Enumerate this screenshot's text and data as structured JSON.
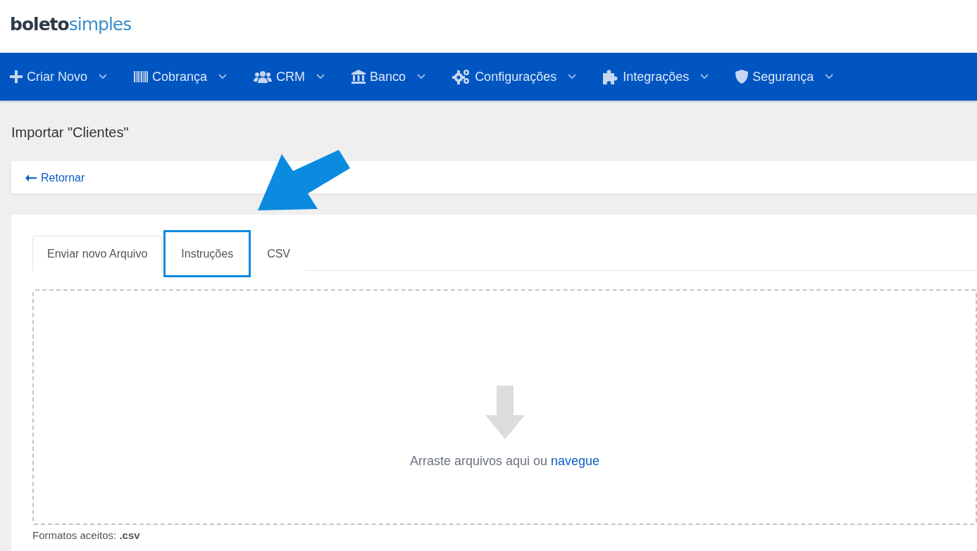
{
  "logo": {
    "part_1": "boleto",
    "part_2": "simples"
  },
  "nav": [
    {
      "label": "Criar Novo"
    },
    {
      "label": "Cobrança"
    },
    {
      "label": "CRM"
    },
    {
      "label": "Banco"
    },
    {
      "label": "Configurações"
    },
    {
      "label": "Integrações"
    },
    {
      "label": "Segurança"
    }
  ],
  "page_title": "Importar \"Clientes\"",
  "back_link": "Retornar",
  "tabs": [
    {
      "label": "Enviar novo Arquivo",
      "selected": true,
      "highlighted": false
    },
    {
      "label": "Instruções",
      "selected": false,
      "highlighted": true
    },
    {
      "label": "CSV",
      "selected": false,
      "highlighted": false
    }
  ],
  "annotation_arrow": true,
  "dropzone": {
    "text": "Arraste arquivos aqui ou",
    "link": "navegue"
  },
  "formats": {
    "label": "Formatos aceitos:",
    "value": ".csv"
  }
}
